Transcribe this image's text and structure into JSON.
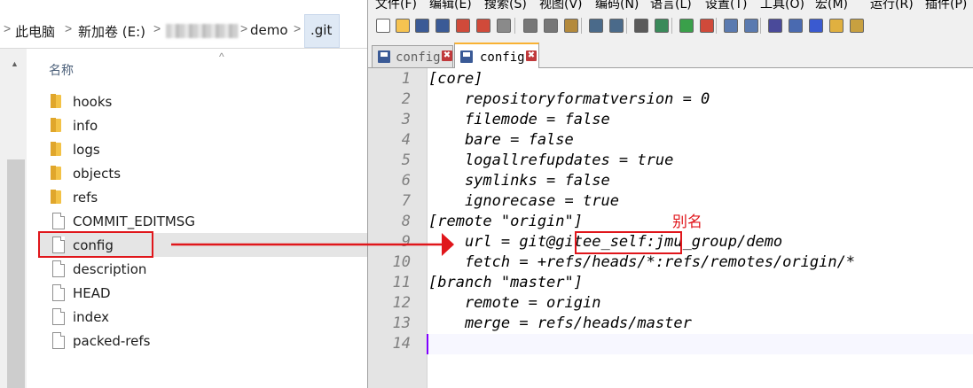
{
  "explorer": {
    "breadcrumb": {
      "this_pc": "此电脑",
      "drive": "新加卷 (E:)",
      "folder": "demo",
      "current": ".git",
      "separator": ">"
    },
    "column_header": "名称",
    "files": [
      {
        "name": "hooks",
        "type": "folder"
      },
      {
        "name": "info",
        "type": "folder"
      },
      {
        "name": "logs",
        "type": "folder"
      },
      {
        "name": "objects",
        "type": "folder"
      },
      {
        "name": "refs",
        "type": "folder"
      },
      {
        "name": "COMMIT_EDITMSG",
        "type": "file"
      },
      {
        "name": "config",
        "type": "file",
        "state": "selected-hover"
      },
      {
        "name": "description",
        "type": "file"
      },
      {
        "name": "HEAD",
        "type": "file"
      },
      {
        "name": "index",
        "type": "file"
      },
      {
        "name": "packed-refs",
        "type": "file"
      }
    ]
  },
  "editor_app": {
    "menu": [
      "文件(F)",
      "编辑(E)",
      "搜索(S)",
      "视图(V)",
      "编码(N)",
      "语言(L)",
      "设置(T)",
      "工具(O)",
      "宏(M)",
      "运行(R)",
      "插件(P)"
    ],
    "tabs": [
      {
        "label": "config",
        "active": false
      },
      {
        "label": "config",
        "active": true
      }
    ],
    "tab_close_glyph": "✖",
    "lines": [
      {
        "n": "1",
        "text": "[core]"
      },
      {
        "n": "2",
        "text": "    repositoryformatversion = 0"
      },
      {
        "n": "3",
        "text": "    filemode = false"
      },
      {
        "n": "4",
        "text": "    bare = false"
      },
      {
        "n": "5",
        "text": "    logallrefupdates = true"
      },
      {
        "n": "6",
        "text": "    symlinks = false"
      },
      {
        "n": "7",
        "text": "    ignorecase = true"
      },
      {
        "n": "8",
        "text": "[remote \"origin\"]"
      },
      {
        "n": "9",
        "text": "    url = git@gitee_self:jmu_group/demo"
      },
      {
        "n": "10",
        "text": "    fetch = +refs/heads/*:refs/remotes/origin/*"
      },
      {
        "n": "11",
        "text": "[branch \"master\"]"
      },
      {
        "n": "12",
        "text": "    remote = origin"
      },
      {
        "n": "13",
        "text": "    merge = refs/heads/master"
      },
      {
        "n": "14",
        "text": ""
      }
    ]
  },
  "annotation": {
    "alias_label": "别名",
    "color": "#e0161b"
  },
  "icons": {
    "toolbar": [
      "new-file-icon",
      "open-file-icon",
      "save-icon",
      "save-all-icon",
      "close-icon",
      "close-all-icon",
      "print-icon",
      "cut-icon",
      "copy-icon",
      "paste-icon",
      "undo-icon",
      "redo-icon",
      "find-icon",
      "replace-icon",
      "zoom-in-icon",
      "zoom-out-icon",
      "sync-v-icon",
      "sync-h-icon",
      "word-wrap-icon",
      "show-all-chars-icon",
      "indent-guide-icon",
      "doc-map-icon",
      "function-list-icon"
    ]
  }
}
